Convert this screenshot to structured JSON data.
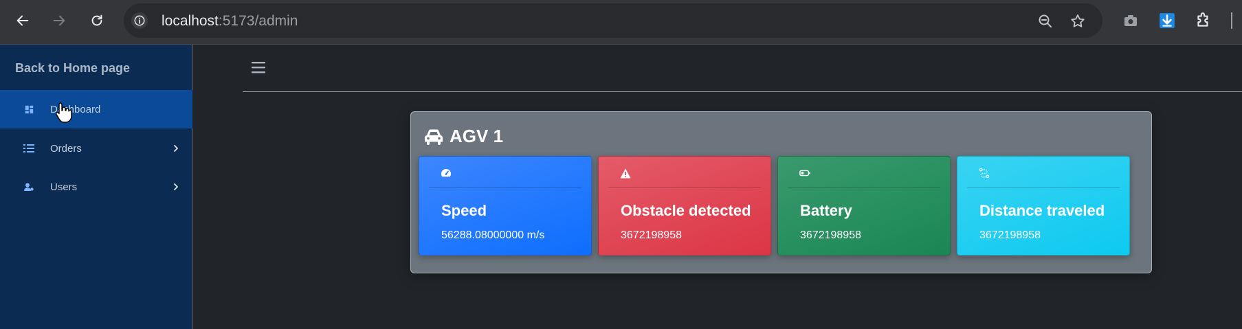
{
  "browser": {
    "url_host": "localhost",
    "url_path": ":5173/admin"
  },
  "sidebar": {
    "back_label": "Back to Home page",
    "items": [
      {
        "label": "Dashboard",
        "icon": "dashboard-icon",
        "active": true,
        "has_chevron": false
      },
      {
        "label": "Orders",
        "icon": "list-icon",
        "active": false,
        "has_chevron": true
      },
      {
        "label": "Users",
        "icon": "users-icon",
        "active": false,
        "has_chevron": true
      }
    ]
  },
  "agv": {
    "title": "AGV 1",
    "cards": [
      {
        "title": "Speed",
        "value": "56288.08000000 m/s",
        "icon": "speedometer-icon",
        "color": "#0d6efd"
      },
      {
        "title": "Obstacle detected",
        "value": "3672198958",
        "icon": "warning-icon",
        "color": "#dc3545"
      },
      {
        "title": "Battery",
        "value": "3672198958",
        "icon": "battery-icon",
        "color": "#198754"
      },
      {
        "title": "Distance traveled",
        "value": "3672198958",
        "icon": "route-icon",
        "color": "#0dcaf0"
      }
    ]
  },
  "colors": {
    "sidebar_bg": "#0b2b52",
    "sidebar_active": "#0a4a96",
    "main_bg": "#212529",
    "panel_bg": "#6c757d"
  }
}
